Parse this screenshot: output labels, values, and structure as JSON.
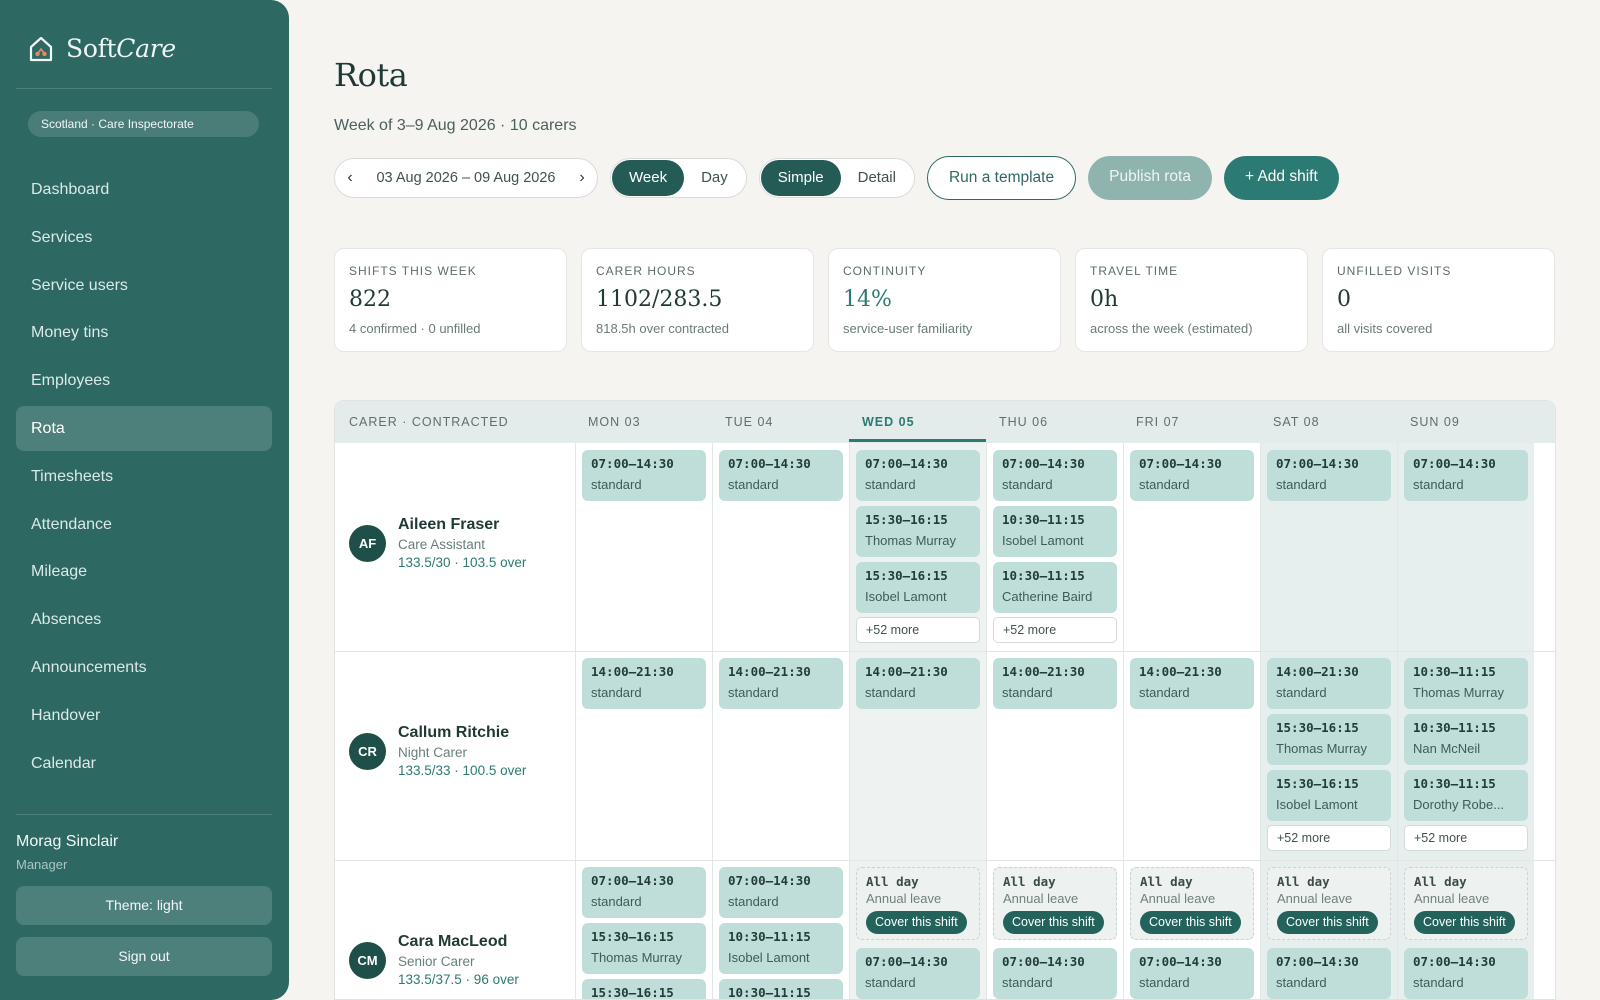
{
  "brand": {
    "prefix": "Soft",
    "suffix": "Care"
  },
  "region": "Scotland · Care Inspectorate",
  "nav": [
    "Dashboard",
    "Services",
    "Service users",
    "Money tins",
    "Employees",
    "Rota",
    "Timesheets",
    "Attendance",
    "Mileage",
    "Absences",
    "Announcements",
    "Handover",
    "Calendar"
  ],
  "active_nav": "Rota",
  "user": {
    "name": "Morag Sinclair",
    "role": "Manager"
  },
  "theme_label": "Theme: light",
  "signout_label": "Sign out",
  "page": {
    "title": "Rota",
    "subtitle": "Week of 3–9 Aug 2026 · 10 carers"
  },
  "toolbar": {
    "prev": "‹",
    "next": "›",
    "date_range": "03 Aug 2026 – 09 Aug 2026",
    "view_week": "Week",
    "view_day": "Day",
    "mode_simple": "Simple",
    "mode_detail": "Detail",
    "run_template": "Run a template",
    "publish": "Publish rota",
    "add_shift": "+ Add shift"
  },
  "stats": [
    {
      "label": "SHIFTS THIS WEEK",
      "value": "822",
      "note": "4 confirmed · 0 unfilled"
    },
    {
      "label": "CARER HOURS",
      "value": "1102/283.5",
      "note": "818.5h over contracted"
    },
    {
      "label": "CONTINUITY",
      "value": "14%",
      "note": "service-user familiarity"
    },
    {
      "label": "TRAVEL TIME",
      "value": "0h",
      "note": "across the week (estimated)"
    },
    {
      "label": "UNFILLED VISITS",
      "value": "0",
      "note": "all visits covered"
    }
  ],
  "grid": {
    "carer_header": "CARER · CONTRACTED",
    "days": [
      "MON 03",
      "TUE 04",
      "WED 05",
      "THU 06",
      "FRI 07",
      "SAT 08",
      "SUN 09"
    ],
    "today_index": 2,
    "rows": [
      {
        "initials": "AF",
        "name": "Aileen Fraser",
        "role": "Care Assistant",
        "hours": "133.5/30 · 103.5 over",
        "days": [
          [
            {
              "kind": "shift",
              "time": "07:00–14:30",
              "sub": "standard"
            }
          ],
          [
            {
              "kind": "shift",
              "time": "07:00–14:30",
              "sub": "standard"
            }
          ],
          [
            {
              "kind": "shift",
              "time": "07:00–14:30",
              "sub": "standard"
            },
            {
              "kind": "shift",
              "time": "15:30–16:15",
              "sub": "Thomas Murray"
            },
            {
              "kind": "shift",
              "time": "15:30–16:15",
              "sub": "Isobel Lamont"
            },
            {
              "kind": "more",
              "label": "+52 more"
            }
          ],
          [
            {
              "kind": "shift",
              "time": "07:00–14:30",
              "sub": "standard"
            },
            {
              "kind": "shift",
              "time": "10:30–11:15",
              "sub": "Isobel Lamont"
            },
            {
              "kind": "shift",
              "time": "10:30–11:15",
              "sub": "Catherine Baird"
            },
            {
              "kind": "more",
              "label": "+52 more"
            }
          ],
          [
            {
              "kind": "shift",
              "time": "07:00–14:30",
              "sub": "standard"
            }
          ],
          [
            {
              "kind": "shift",
              "time": "07:00–14:30",
              "sub": "standard"
            }
          ],
          [
            {
              "kind": "shift",
              "time": "07:00–14:30",
              "sub": "standard"
            }
          ]
        ]
      },
      {
        "initials": "CR",
        "name": "Callum Ritchie",
        "role": "Night Carer",
        "hours": "133.5/33 · 100.5 over",
        "days": [
          [
            {
              "kind": "shift",
              "time": "14:00–21:30",
              "sub": "standard"
            }
          ],
          [
            {
              "kind": "shift",
              "time": "14:00–21:30",
              "sub": "standard"
            }
          ],
          [
            {
              "kind": "shift",
              "time": "14:00–21:30",
              "sub": "standard"
            }
          ],
          [
            {
              "kind": "shift",
              "time": "14:00–21:30",
              "sub": "standard"
            }
          ],
          [
            {
              "kind": "shift",
              "time": "14:00–21:30",
              "sub": "standard"
            }
          ],
          [
            {
              "kind": "shift",
              "time": "14:00–21:30",
              "sub": "standard"
            },
            {
              "kind": "shift",
              "time": "15:30–16:15",
              "sub": "Thomas Murray"
            },
            {
              "kind": "shift",
              "time": "15:30–16:15",
              "sub": "Isobel Lamont"
            },
            {
              "kind": "more",
              "label": "+52 more"
            }
          ],
          [
            {
              "kind": "shift",
              "time": "10:30–11:15",
              "sub": "Thomas Murray"
            },
            {
              "kind": "shift",
              "time": "10:30–11:15",
              "sub": "Nan McNeil"
            },
            {
              "kind": "shift",
              "time": "10:30–11:15",
              "sub": "Dorothy Robe..."
            },
            {
              "kind": "more",
              "label": "+52 more"
            }
          ]
        ]
      },
      {
        "initials": "CM",
        "name": "Cara MacLeod",
        "role": "Senior Carer",
        "hours": "133.5/37.5 · 96 over",
        "days": [
          [
            {
              "kind": "shift",
              "time": "07:00–14:30",
              "sub": "standard"
            },
            {
              "kind": "shift",
              "time": "15:30–16:15",
              "sub": "Thomas Murray"
            },
            {
              "kind": "shift",
              "time": "15:30–16:15",
              "sub": ""
            }
          ],
          [
            {
              "kind": "shift",
              "time": "07:00–14:30",
              "sub": "standard"
            },
            {
              "kind": "shift",
              "time": "10:30–11:15",
              "sub": "Isobel Lamont"
            },
            {
              "kind": "shift",
              "time": "10:30–11:15",
              "sub": ""
            }
          ],
          [
            {
              "kind": "leave",
              "time": "All day",
              "sub": "Annual leave",
              "action": "Cover this shift"
            },
            {
              "kind": "shift",
              "time": "07:00–14:30",
              "sub": "standard"
            }
          ],
          [
            {
              "kind": "leave",
              "time": "All day",
              "sub": "Annual leave",
              "action": "Cover this shift"
            },
            {
              "kind": "shift",
              "time": "07:00–14:30",
              "sub": "standard"
            }
          ],
          [
            {
              "kind": "leave",
              "time": "All day",
              "sub": "Annual leave",
              "action": "Cover this shift"
            },
            {
              "kind": "shift",
              "time": "07:00–14:30",
              "sub": "standard"
            }
          ],
          [
            {
              "kind": "leave",
              "time": "All day",
              "sub": "Annual leave",
              "action": "Cover this shift"
            },
            {
              "kind": "shift",
              "time": "07:00–14:30",
              "sub": "standard"
            }
          ],
          [
            {
              "kind": "leave",
              "time": "All day",
              "sub": "Annual leave",
              "action": "Cover this shift"
            },
            {
              "kind": "shift",
              "time": "07:00–14:30",
              "sub": "standard"
            }
          ]
        ]
      }
    ]
  },
  "colors": {
    "sidebar": "#2d6862",
    "accent": "#2b7a73",
    "chip": "#bfdeda",
    "today_tint": "#eef3f1",
    "weekend_tint": "#e6efed"
  }
}
